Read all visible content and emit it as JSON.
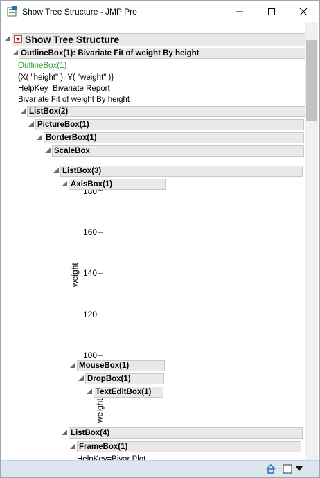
{
  "window": {
    "title": "Show Tree Structure - JMP Pro",
    "controls": [
      "minimize",
      "maximize",
      "close"
    ]
  },
  "tree": {
    "root_title": "Show Tree Structure",
    "outline_header": "OutlineBox(1): Bivariate Fit of weight By height",
    "info_lines": {
      "name": "OutlineBox(1)",
      "xy": "{X( \"height\" ), Y( \"weight\" )}",
      "helpkey": "HelpKey=Bivariate Report",
      "title": "Bivariate Fit of weight By height"
    },
    "nodes": {
      "listbox2": "ListBox(2)",
      "picturebox1": "PictureBox(1)",
      "borderbox1": "BorderBox(1)",
      "scalebox": "ScaleBox",
      "listbox3": "ListBox(3)",
      "axisbox1": "AxisBox(1)",
      "mousebox1": "MouseBox(1)",
      "dropbox1": "DropBox(1)",
      "texteditbox1": "TextEditBox(1)",
      "listbox4": "ListBox(4)",
      "framebox1": "FrameBox(1)",
      "helpkey_partial": "HelpKey=Bivar Plot"
    },
    "axis": {
      "label": "weight",
      "ticks": [
        "180",
        "160",
        "140",
        "120",
        "100"
      ]
    },
    "textedit_label": "weight"
  },
  "colors": {
    "accent_green": "#2ca02c",
    "red_button": "#d01010",
    "header_bg": "#e9e9e9",
    "status_bar": "#dde6ef"
  },
  "statusbar": {
    "icons": [
      "home-icon",
      "checkbox-icon",
      "dropdown-arrow-icon"
    ]
  }
}
